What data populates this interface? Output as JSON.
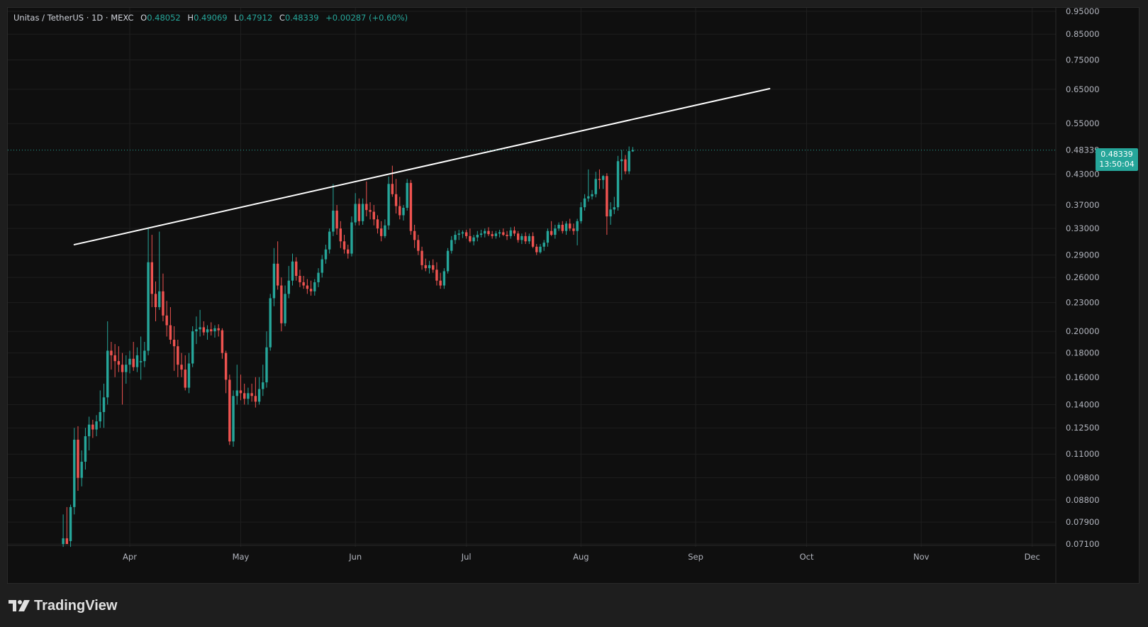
{
  "legend": {
    "symbol": "Unitas / TetherUS · 1D · MEXC",
    "open_label": "O",
    "open": "0.48052",
    "high_label": "H",
    "high": "0.49069",
    "low_label": "L",
    "low": "0.47912",
    "close_label": "C",
    "close": "0.48339",
    "change": "+0.00287 (+0.60%)"
  },
  "price_tag": {
    "price": "0.48339",
    "countdown": "13:50:04"
  },
  "brand": {
    "name": "TradingView"
  },
  "colors": {
    "up": "#26a69a",
    "down": "#ef5350",
    "trendline": "#ffffff",
    "background": "#0f0f0f",
    "grid": "#1f1f1f"
  },
  "chart_data": {
    "type": "candlestick",
    "scale": "log",
    "ylim": [
      0.07,
      0.96
    ],
    "y_ticks": [
      "0.95000",
      "0.85000",
      "0.75000",
      "0.65000",
      "0.55000",
      "0.48339",
      "0.43000",
      "0.37000",
      "0.33000",
      "0.29000",
      "0.26000",
      "0.23000",
      "0.20000",
      "0.18000",
      "0.16000",
      "0.14000",
      "0.12500",
      "0.11000",
      "0.09800",
      "0.08800",
      "0.07900",
      "0.07100"
    ],
    "x_ticks": [
      "Apr",
      "May",
      "Jun",
      "Jul",
      "Aug",
      "Sep",
      "Oct",
      "Nov",
      "Dec"
    ],
    "x_range": [
      "2025-03-10",
      "2025-12-12"
    ],
    "candles_ohlc": [
      [
        "2025-03-14",
        0.071,
        0.082,
        0.07,
        0.073
      ],
      [
        "2025-03-15",
        0.073,
        0.085,
        0.071,
        0.071
      ],
      [
        "2025-03-16",
        0.072,
        0.086,
        0.07,
        0.085
      ],
      [
        "2025-03-17",
        0.085,
        0.125,
        0.082,
        0.118
      ],
      [
        "2025-03-18",
        0.118,
        0.126,
        0.092,
        0.098
      ],
      [
        "2025-03-19",
        0.098,
        0.112,
        0.094,
        0.106
      ],
      [
        "2025-03-20",
        0.106,
        0.125,
        0.102,
        0.12
      ],
      [
        "2025-03-21",
        0.12,
        0.132,
        0.112,
        0.127
      ],
      [
        "2025-03-22",
        0.127,
        0.13,
        0.119,
        0.124
      ],
      [
        "2025-03-23",
        0.124,
        0.133,
        0.12,
        0.129
      ],
      [
        "2025-03-24",
        0.129,
        0.15,
        0.125,
        0.135
      ],
      [
        "2025-03-25",
        0.135,
        0.155,
        0.125,
        0.145
      ],
      [
        "2025-03-26",
        0.145,
        0.21,
        0.14,
        0.182
      ],
      [
        "2025-03-27",
        0.182,
        0.19,
        0.166,
        0.178
      ],
      [
        "2025-03-28",
        0.178,
        0.188,
        0.16,
        0.173
      ],
      [
        "2025-03-29",
        0.173,
        0.186,
        0.164,
        0.17
      ],
      [
        "2025-03-30",
        0.17,
        0.18,
        0.14,
        0.164
      ],
      [
        "2025-03-31",
        0.164,
        0.178,
        0.155,
        0.17
      ],
      [
        "2025-04-01",
        0.17,
        0.182,
        0.163,
        0.175
      ],
      [
        "2025-04-02",
        0.175,
        0.19,
        0.165,
        0.168
      ],
      [
        "2025-04-03",
        0.168,
        0.185,
        0.164,
        0.178
      ],
      [
        "2025-04-04",
        0.172,
        0.195,
        0.158,
        0.173
      ],
      [
        "2025-04-05",
        0.173,
        0.19,
        0.168,
        0.182
      ],
      [
        "2025-04-06",
        0.182,
        0.33,
        0.178,
        0.28
      ],
      [
        "2025-04-07",
        0.28,
        0.32,
        0.225,
        0.24
      ],
      [
        "2025-04-08",
        0.24,
        0.255,
        0.21,
        0.225
      ],
      [
        "2025-04-09",
        0.225,
        0.325,
        0.222,
        0.243
      ],
      [
        "2025-04-10",
        0.243,
        0.265,
        0.21,
        0.216
      ],
      [
        "2025-04-11",
        0.216,
        0.232,
        0.195,
        0.206
      ],
      [
        "2025-04-12",
        0.206,
        0.225,
        0.188,
        0.192
      ],
      [
        "2025-04-13",
        0.192,
        0.205,
        0.165,
        0.186
      ],
      [
        "2025-04-14",
        0.186,
        0.192,
        0.16,
        0.17
      ],
      [
        "2025-04-15",
        0.17,
        0.18,
        0.16,
        0.166
      ],
      [
        "2025-04-16",
        0.166,
        0.178,
        0.15,
        0.152
      ],
      [
        "2025-04-17",
        0.152,
        0.18,
        0.148,
        0.171
      ],
      [
        "2025-04-18",
        0.171,
        0.205,
        0.168,
        0.2
      ],
      [
        "2025-04-19",
        0.2,
        0.215,
        0.188,
        0.202
      ],
      [
        "2025-04-20",
        0.202,
        0.222,
        0.195,
        0.204
      ],
      [
        "2025-04-21",
        0.204,
        0.21,
        0.196,
        0.199
      ],
      [
        "2025-04-22",
        0.199,
        0.206,
        0.192,
        0.202
      ],
      [
        "2025-04-23",
        0.202,
        0.209,
        0.196,
        0.2
      ],
      [
        "2025-04-24",
        0.2,
        0.206,
        0.194,
        0.203
      ],
      [
        "2025-04-25",
        0.203,
        0.207,
        0.195,
        0.201
      ],
      [
        "2025-04-26",
        0.201,
        0.203,
        0.175,
        0.18
      ],
      [
        "2025-04-27",
        0.18,
        0.182,
        0.148,
        0.158
      ],
      [
        "2025-04-28",
        0.158,
        0.162,
        0.115,
        0.117
      ],
      [
        "2025-04-29",
        0.117,
        0.15,
        0.114,
        0.146
      ],
      [
        "2025-04-30",
        0.146,
        0.17,
        0.14,
        0.15
      ],
      [
        "2025-05-01",
        0.15,
        0.162,
        0.143,
        0.148
      ],
      [
        "2025-05-02",
        0.148,
        0.155,
        0.14,
        0.144
      ],
      [
        "2025-05-03",
        0.144,
        0.152,
        0.14,
        0.148
      ],
      [
        "2025-05-04",
        0.148,
        0.155,
        0.142,
        0.146
      ],
      [
        "2025-05-05",
        0.146,
        0.16,
        0.138,
        0.142
      ],
      [
        "2025-05-06",
        0.142,
        0.16,
        0.14,
        0.151
      ],
      [
        "2025-05-07",
        0.151,
        0.17,
        0.146,
        0.156
      ],
      [
        "2025-05-08",
        0.156,
        0.2,
        0.152,
        0.185
      ],
      [
        "2025-05-09",
        0.185,
        0.24,
        0.182,
        0.235
      ],
      [
        "2025-05-10",
        0.235,
        0.3,
        0.226,
        0.278
      ],
      [
        "2025-05-11",
        0.278,
        0.31,
        0.245,
        0.25
      ],
      [
        "2025-05-12",
        0.25,
        0.26,
        0.2,
        0.208
      ],
      [
        "2025-05-13",
        0.208,
        0.25,
        0.205,
        0.24
      ],
      [
        "2025-05-14",
        0.24,
        0.275,
        0.235,
        0.256
      ],
      [
        "2025-05-15",
        0.256,
        0.292,
        0.25,
        0.281
      ],
      [
        "2025-05-16",
        0.281,
        0.287,
        0.256,
        0.262
      ],
      [
        "2025-05-17",
        0.262,
        0.27,
        0.248,
        0.254
      ],
      [
        "2025-05-18",
        0.254,
        0.262,
        0.246,
        0.25
      ],
      [
        "2025-05-19",
        0.25,
        0.258,
        0.24,
        0.246
      ],
      [
        "2025-05-20",
        0.246,
        0.256,
        0.238,
        0.243
      ],
      [
        "2025-05-21",
        0.243,
        0.258,
        0.238,
        0.254
      ],
      [
        "2025-05-22",
        0.254,
        0.272,
        0.248,
        0.266
      ],
      [
        "2025-05-23",
        0.266,
        0.29,
        0.26,
        0.284
      ],
      [
        "2025-05-24",
        0.284,
        0.305,
        0.278,
        0.298
      ],
      [
        "2025-05-25",
        0.298,
        0.33,
        0.292,
        0.325
      ],
      [
        "2025-05-26",
        0.325,
        0.41,
        0.318,
        0.36
      ],
      [
        "2025-05-27",
        0.36,
        0.37,
        0.32,
        0.33
      ],
      [
        "2025-05-28",
        0.33,
        0.342,
        0.3,
        0.31
      ],
      [
        "2025-05-29",
        0.31,
        0.32,
        0.292,
        0.298
      ],
      [
        "2025-05-30",
        0.298,
        0.305,
        0.285,
        0.292
      ],
      [
        "2025-05-31",
        0.292,
        0.35,
        0.288,
        0.34
      ],
      [
        "2025-06-01",
        0.34,
        0.392,
        0.335,
        0.372
      ],
      [
        "2025-06-02",
        0.372,
        0.382,
        0.335,
        0.342
      ],
      [
        "2025-06-03",
        0.342,
        0.382,
        0.336,
        0.372
      ],
      [
        "2025-06-04",
        0.372,
        0.415,
        0.35,
        0.361
      ],
      [
        "2025-06-05",
        0.361,
        0.375,
        0.345,
        0.358
      ],
      [
        "2025-06-06",
        0.358,
        0.37,
        0.335,
        0.345
      ],
      [
        "2025-06-07",
        0.345,
        0.352,
        0.322,
        0.33
      ],
      [
        "2025-06-08",
        0.33,
        0.342,
        0.31,
        0.318
      ],
      [
        "2025-06-09",
        0.318,
        0.345,
        0.315,
        0.335
      ],
      [
        "2025-06-10",
        0.335,
        0.425,
        0.328,
        0.41
      ],
      [
        "2025-06-11",
        0.41,
        0.448,
        0.385,
        0.39
      ],
      [
        "2025-06-12",
        0.39,
        0.42,
        0.355,
        0.368
      ],
      [
        "2025-06-13",
        0.368,
        0.385,
        0.345,
        0.352
      ],
      [
        "2025-06-14",
        0.352,
        0.37,
        0.343,
        0.365
      ],
      [
        "2025-06-15",
        0.365,
        0.42,
        0.36,
        0.412
      ],
      [
        "2025-06-16",
        0.412,
        0.418,
        0.32,
        0.326
      ],
      [
        "2025-06-17",
        0.326,
        0.336,
        0.3,
        0.312
      ],
      [
        "2025-06-18",
        0.312,
        0.32,
        0.29,
        0.296
      ],
      [
        "2025-06-19",
        0.296,
        0.302,
        0.27,
        0.276
      ],
      [
        "2025-06-20",
        0.276,
        0.285,
        0.268,
        0.272
      ],
      [
        "2025-06-21",
        0.272,
        0.282,
        0.265,
        0.276
      ],
      [
        "2025-06-22",
        0.276,
        0.284,
        0.266,
        0.27
      ],
      [
        "2025-06-23",
        0.27,
        0.28,
        0.25,
        0.256
      ],
      [
        "2025-06-24",
        0.256,
        0.266,
        0.246,
        0.25
      ],
      [
        "2025-06-25",
        0.25,
        0.272,
        0.246,
        0.268
      ],
      [
        "2025-06-26",
        0.268,
        0.3,
        0.265,
        0.296
      ],
      [
        "2025-06-27",
        0.296,
        0.318,
        0.292,
        0.312
      ],
      [
        "2025-06-28",
        0.312,
        0.326,
        0.306,
        0.32
      ],
      [
        "2025-06-29",
        0.32,
        0.328,
        0.312,
        0.322
      ],
      [
        "2025-06-30",
        0.322,
        0.327,
        0.315,
        0.324
      ],
      [
        "2025-07-01",
        0.324,
        0.328,
        0.314,
        0.318
      ],
      [
        "2025-07-02",
        0.318,
        0.33,
        0.308,
        0.31
      ],
      [
        "2025-07-03",
        0.31,
        0.32,
        0.304,
        0.316
      ],
      [
        "2025-07-04",
        0.316,
        0.326,
        0.31,
        0.32
      ],
      [
        "2025-07-05",
        0.32,
        0.328,
        0.316,
        0.322
      ],
      [
        "2025-07-06",
        0.322,
        0.33,
        0.316,
        0.326
      ],
      [
        "2025-07-07",
        0.326,
        0.332,
        0.318,
        0.321
      ],
      [
        "2025-07-08",
        0.321,
        0.326,
        0.314,
        0.318
      ],
      [
        "2025-07-09",
        0.318,
        0.326,
        0.314,
        0.322
      ],
      [
        "2025-07-10",
        0.322,
        0.328,
        0.316,
        0.324
      ],
      [
        "2025-07-11",
        0.324,
        0.33,
        0.318,
        0.32
      ],
      [
        "2025-07-12",
        0.32,
        0.326,
        0.312,
        0.318
      ],
      [
        "2025-07-13",
        0.318,
        0.332,
        0.314,
        0.327
      ],
      [
        "2025-07-14",
        0.327,
        0.333,
        0.318,
        0.322
      ],
      [
        "2025-07-15",
        0.322,
        0.326,
        0.308,
        0.312
      ],
      [
        "2025-07-16",
        0.312,
        0.322,
        0.306,
        0.318
      ],
      [
        "2025-07-17",
        0.318,
        0.324,
        0.306,
        0.31
      ],
      [
        "2025-07-18",
        0.31,
        0.322,
        0.306,
        0.318
      ],
      [
        "2025-07-19",
        0.318,
        0.324,
        0.3,
        0.302
      ],
      [
        "2025-07-20",
        0.302,
        0.306,
        0.29,
        0.294
      ],
      [
        "2025-07-21",
        0.294,
        0.306,
        0.292,
        0.302
      ],
      [
        "2025-07-22",
        0.302,
        0.312,
        0.296,
        0.308
      ],
      [
        "2025-07-23",
        0.308,
        0.33,
        0.302,
        0.326
      ],
      [
        "2025-07-24",
        0.326,
        0.342,
        0.318,
        0.32
      ],
      [
        "2025-07-25",
        0.32,
        0.336,
        0.314,
        0.33
      ],
      [
        "2025-07-26",
        0.33,
        0.34,
        0.326,
        0.336
      ],
      [
        "2025-07-27",
        0.336,
        0.342,
        0.322,
        0.326
      ],
      [
        "2025-07-28",
        0.326,
        0.342,
        0.32,
        0.338
      ],
      [
        "2025-07-29",
        0.338,
        0.346,
        0.326,
        0.33
      ],
      [
        "2025-07-30",
        0.33,
        0.338,
        0.32,
        0.326
      ],
      [
        "2025-07-31",
        0.326,
        0.346,
        0.304,
        0.342
      ],
      [
        "2025-08-01",
        0.342,
        0.375,
        0.338,
        0.366
      ],
      [
        "2025-08-02",
        0.366,
        0.39,
        0.36,
        0.382
      ],
      [
        "2025-08-03",
        0.382,
        0.44,
        0.376,
        0.386
      ],
      [
        "2025-08-04",
        0.386,
        0.398,
        0.38,
        0.39
      ],
      [
        "2025-08-05",
        0.39,
        0.435,
        0.384,
        0.42
      ],
      [
        "2025-08-06",
        0.42,
        0.44,
        0.4,
        0.418
      ],
      [
        "2025-08-07",
        0.418,
        0.428,
        0.4,
        0.426
      ],
      [
        "2025-08-08",
        0.426,
        0.432,
        0.32,
        0.35
      ],
      [
        "2025-08-09",
        0.35,
        0.375,
        0.336,
        0.362
      ],
      [
        "2025-08-10",
        0.362,
        0.385,
        0.354,
        0.366
      ],
      [
        "2025-08-11",
        0.366,
        0.47,
        0.36,
        0.458
      ],
      [
        "2025-08-12",
        0.458,
        0.484,
        0.418,
        0.462
      ],
      [
        "2025-08-13",
        0.462,
        0.472,
        0.43,
        0.436
      ],
      [
        "2025-08-14",
        0.436,
        0.492,
        0.43,
        0.481
      ],
      [
        "2025-08-15",
        0.4805,
        0.4907,
        0.4791,
        0.4834
      ]
    ],
    "trendline": {
      "from": [
        "2025-03-17",
        0.305
      ],
      "to": [
        "2025-09-21",
        0.652
      ]
    },
    "last_price": 0.48339
  }
}
